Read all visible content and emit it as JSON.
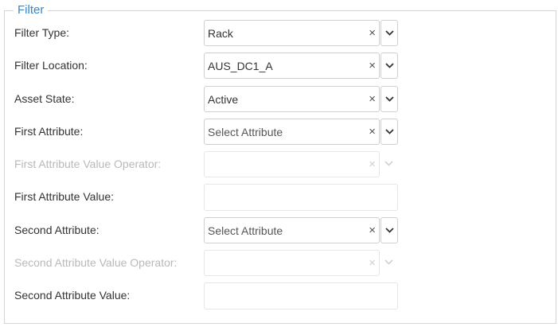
{
  "filter": {
    "legend": "Filter",
    "rows": [
      {
        "label": "Filter Type:",
        "value": "Rack",
        "clear": "×"
      },
      {
        "label": "Filter Location:",
        "value": "AUS_DC1_A",
        "clear": "×"
      },
      {
        "label": "Asset State:",
        "value": "Active",
        "clear": "×"
      },
      {
        "label": "First Attribute:",
        "value": "Select Attribute",
        "clear": "×"
      },
      {
        "label": "First Attribute Value Operator:",
        "value": "",
        "clear": "×"
      },
      {
        "label": "First Attribute Value:",
        "value": ""
      },
      {
        "label": "Second Attribute:",
        "value": "Select Attribute",
        "clear": "×"
      },
      {
        "label": "Second Attribute Value Operator:",
        "value": "",
        "clear": "×"
      },
      {
        "label": "Second Attribute Value:",
        "value": ""
      }
    ]
  },
  "icons": {
    "clear": "close-icon",
    "dropdown": "chevron-down-icon"
  },
  "colors": {
    "legend": "#3a86c8",
    "label": "#333333",
    "label_disabled": "#b9b9b9",
    "border": "#cfcfcf"
  }
}
